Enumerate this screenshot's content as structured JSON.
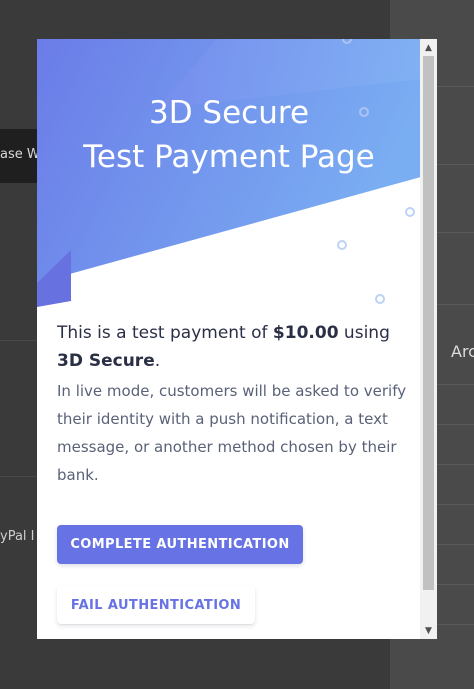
{
  "background": {
    "left_button_label": "ase W",
    "paypal_text": "yPal I",
    "right_heading": "Arc"
  },
  "modal": {
    "title_line1": "3D Secure",
    "title_line2": "Test Payment Page",
    "lead_prefix": "This is a test payment of ",
    "lead_amount": "$10.00",
    "lead_middle": " using ",
    "lead_method": "3D Secure",
    "lead_suffix": ".",
    "description": "In live mode, customers will be asked to verify their identity with a push notification, a text message, or another method chosen by their bank.",
    "complete_button": "COMPLETE AUTHENTICATION",
    "fail_button": "FAIL AUTHENTICATION"
  },
  "colors": {
    "accent": "#6772e5",
    "hero_light": "#7aa9f3",
    "hero_dark": "#6b74e6",
    "text_dark": "#2a2f45",
    "text_muted": "#5a6278"
  },
  "icons": {
    "scroll_up": "triangle-up-icon",
    "scroll_down": "triangle-down-icon"
  }
}
